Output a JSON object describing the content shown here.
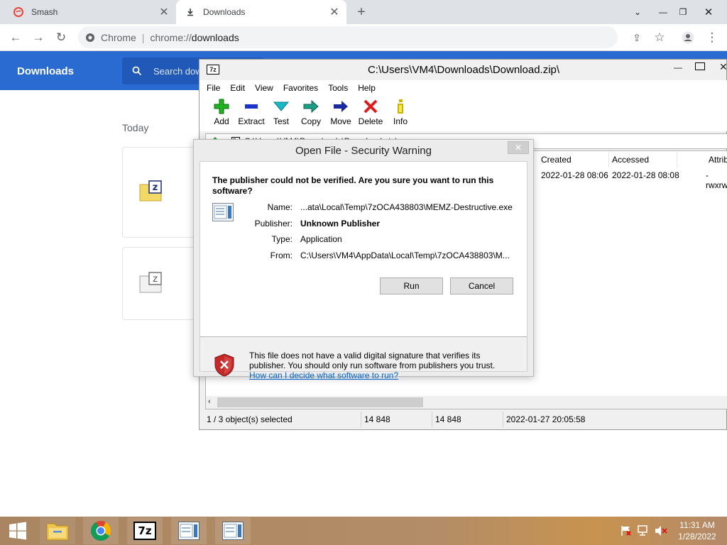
{
  "browser": {
    "tabs": [
      {
        "label": "Smash",
        "icon": "smash-icon"
      },
      {
        "label": "Downloads",
        "icon": "download-icon"
      }
    ],
    "address": {
      "chip": "Chrome",
      "url_scheme": "chrome://",
      "url_path": "downloads"
    }
  },
  "downloads_page": {
    "title": "Downloads",
    "search_placeholder": "Search dow",
    "section": "Today"
  },
  "zip_window": {
    "title": "C:\\Users\\VM4\\Downloads\\Download.zip\\",
    "app_icon_label": "7z",
    "menu": [
      "File",
      "Edit",
      "View",
      "Favorites",
      "Tools",
      "Help"
    ],
    "tools": [
      {
        "label": "Add",
        "icon": "add-icon",
        "color": "#1fb21f"
      },
      {
        "label": "Extract",
        "icon": "extract-icon",
        "color": "#1a33c8"
      },
      {
        "label": "Test",
        "icon": "test-icon",
        "color": "#18b7c7"
      },
      {
        "label": "Copy",
        "icon": "copy-icon",
        "color": "#1a9e86"
      },
      {
        "label": "Move",
        "icon": "move-icon",
        "color": "#1a2a9e"
      },
      {
        "label": "Delete",
        "icon": "delete-icon",
        "color": "#dd1c1c"
      },
      {
        "label": "Info",
        "icon": "info-icon",
        "color": "#c9b400"
      }
    ],
    "path_partial": "C:\\Users\\VM4\\Downloads\\Download.zip\\",
    "columns": [
      "Created",
      "Accessed",
      "Attrib"
    ],
    "row": {
      "created": "2022-01-28 08:06",
      "accessed": "2022-01-28 08:08",
      "attrib": "-rwxrw"
    },
    "status": [
      "1 / 3 object(s) selected",
      "14 848",
      "14 848",
      "2022-01-27 20:05:58"
    ]
  },
  "dialog": {
    "title": "Open File - Security Warning",
    "question": "The publisher could not be verified.  Are you sure you want to run this software?",
    "fields": [
      {
        "label": "Name:",
        "value": "...ata\\Local\\Temp\\7zOCA438803\\MEMZ-Destructive.exe"
      },
      {
        "label": "Publisher:",
        "value": "Unknown Publisher"
      },
      {
        "label": "Type:",
        "value": "Application"
      },
      {
        "label": "From:",
        "value": "C:\\Users\\VM4\\AppData\\Local\\Temp\\7zOCA438803\\M..."
      }
    ],
    "run_label": "Run",
    "cancel_label": "Cancel",
    "footer_text": "This file does not have a valid digital signature that verifies its publisher.  You should only run software from publishers you trust.",
    "footer_link": "How can I decide what software to run?"
  },
  "taskbar": {
    "time": "11:31 AM",
    "date": "1/28/2022",
    "apps": [
      "file-explorer-icon",
      "chrome-icon",
      "7zip-icon",
      "exe-window-icon",
      "exe-window-icon"
    ]
  }
}
